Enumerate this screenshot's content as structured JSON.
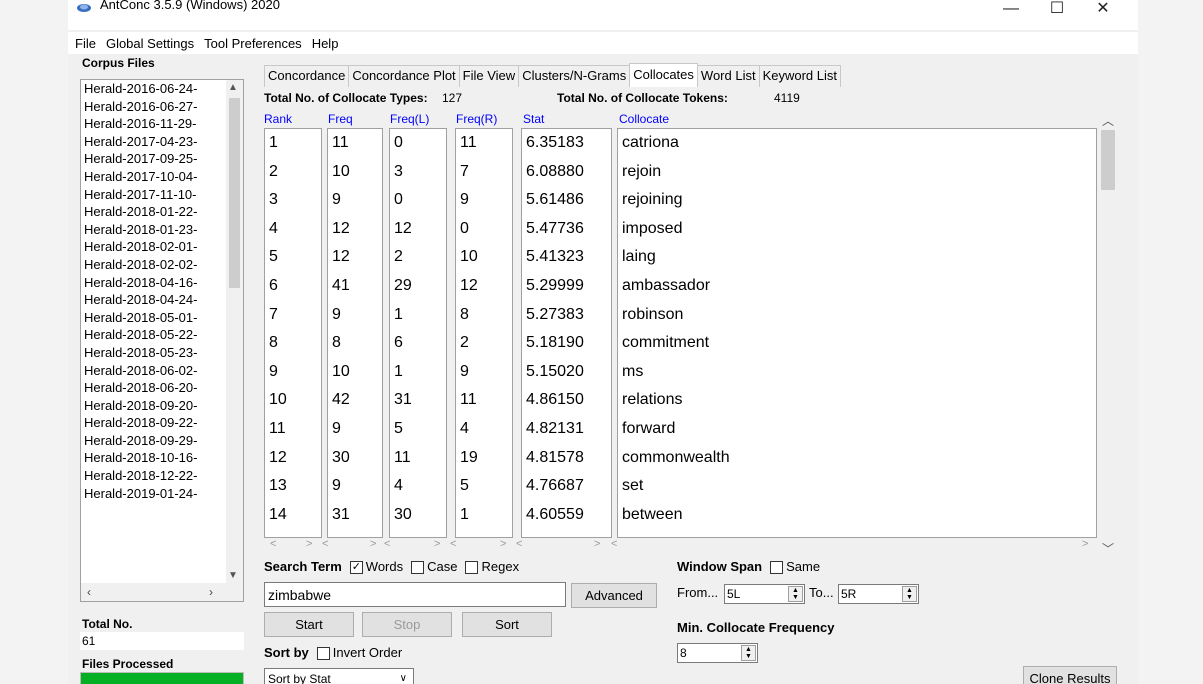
{
  "window": {
    "title": "AntConc 3.5.9 (Windows) 2020",
    "controls": {
      "minimize": "—",
      "maximize": "☐",
      "close": "✕"
    }
  },
  "menu": [
    "File",
    "Global Settings",
    "Tool Preferences",
    "Help"
  ],
  "corpus": {
    "label": "Corpus Files",
    "files": [
      "Herald-2016-06-24-",
      "Herald-2016-06-27-",
      "Herald-2016-11-29-",
      "Herald-2017-04-23-",
      "Herald-2017-09-25-",
      "Herald-2017-10-04-",
      "Herald-2017-11-10-",
      "Herald-2018-01-22-",
      "Herald-2018-01-23-",
      "Herald-2018-02-01-",
      "Herald-2018-02-02-",
      "Herald-2018-04-16-",
      "Herald-2018-04-24-",
      "Herald-2018-05-01-",
      "Herald-2018-05-22-",
      "Herald-2018-05-23-",
      "Herald-2018-06-02-",
      "Herald-2018-06-20-",
      "Herald-2018-09-20-",
      "Herald-2018-09-22-",
      "Herald-2018-09-29-",
      "Herald-2018-10-16-",
      "Herald-2018-12-22-",
      "Herald-2019-01-24-"
    ],
    "total_label": "Total No.",
    "total_value": "61",
    "processed_label": "Files Processed",
    "processed_fraction": 1.0
  },
  "tabs": [
    {
      "label": "Concordance",
      "active": false
    },
    {
      "label": "Concordance Plot",
      "active": false
    },
    {
      "label": "File View",
      "active": false
    },
    {
      "label": "Clusters/N-Grams",
      "active": false
    },
    {
      "label": "Collocates",
      "active": true
    },
    {
      "label": "Word List",
      "active": false
    },
    {
      "label": "Keyword List",
      "active": false
    }
  ],
  "summary": {
    "types_label": "Total No. of Collocate Types:",
    "types_value": "127",
    "tokens_label": "Total No. of Collocate Tokens:",
    "tokens_value": "4119"
  },
  "columns": [
    "Rank",
    "Freq",
    "Freq(L)",
    "Freq(R)",
    "Stat",
    "Collocate"
  ],
  "rows": [
    [
      "1",
      "11",
      "0",
      "11",
      "6.35183",
      "catriona"
    ],
    [
      "2",
      "10",
      "3",
      "7",
      "6.08880",
      "rejoin"
    ],
    [
      "3",
      "9",
      "0",
      "9",
      "5.61486",
      "rejoining"
    ],
    [
      "4",
      "12",
      "12",
      "0",
      "5.47736",
      "imposed"
    ],
    [
      "5",
      "12",
      "2",
      "10",
      "5.41323",
      "laing"
    ],
    [
      "6",
      "41",
      "29",
      "12",
      "5.29999",
      "ambassador"
    ],
    [
      "7",
      "9",
      "1",
      "8",
      "5.27383",
      "robinson"
    ],
    [
      "8",
      "8",
      "6",
      "2",
      "5.18190",
      "commitment"
    ],
    [
      "9",
      "10",
      "1",
      "9",
      "5.15020",
      "ms"
    ],
    [
      "10",
      "42",
      "31",
      "11",
      "4.86150",
      "relations"
    ],
    [
      "11",
      "9",
      "5",
      "4",
      "4.82131",
      "forward"
    ],
    [
      "12",
      "30",
      "11",
      "19",
      "4.81578",
      "commonwealth"
    ],
    [
      "13",
      "9",
      "4",
      "5",
      "4.76687",
      "set"
    ],
    [
      "14",
      "31",
      "30",
      "1",
      "4.60559",
      "between"
    ]
  ],
  "search": {
    "term_label": "Search Term",
    "words_label": "Words",
    "words_checked": true,
    "case_label": "Case",
    "case_checked": false,
    "regex_label": "Regex",
    "regex_checked": false,
    "value": "zimbabwe",
    "advanced_label": "Advanced",
    "start_label": "Start",
    "stop_label": "Stop",
    "sort_label": "Sort",
    "sortby_label": "Sort by",
    "invert_label": "Invert Order",
    "invert_checked": false,
    "sortby_value": "Sort by Stat"
  },
  "window_span": {
    "label": "Window Span",
    "same_label": "Same",
    "same_checked": false,
    "from_label": "From...",
    "from_value": "5L",
    "to_label": "To...",
    "to_value": "5R",
    "minfreq_label": "Min. Collocate Frequency",
    "minfreq_value": "8"
  },
  "clone_label": "Clone Results",
  "colors": {
    "header_blue": "#0000ff",
    "progress_green": "#06b025"
  }
}
